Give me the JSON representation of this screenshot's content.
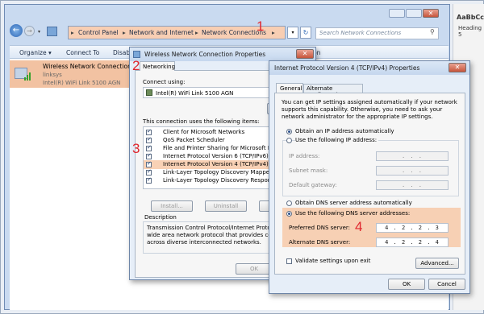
{
  "explorer": {
    "breadcrumb": [
      "Control Panel",
      "Network and Internet",
      "Network Connections"
    ],
    "breadcrumb_sep": "▸",
    "search_placeholder": "Search Network Connections",
    "toolbar": [
      "Organize ▾",
      "Connect To",
      "Disab",
      "ion"
    ],
    "connection": {
      "name": "Wireless Network Connection",
      "ssid": "linksys",
      "adapter": "Intel(R) WiFi Link 5100 AGN"
    }
  },
  "word": {
    "style_preview": "AaBbCcDd",
    "style_name": "Heading 5"
  },
  "props": {
    "title": "Wireless Network Connection Properties",
    "tab": "Networking",
    "connect_using_label": "Connect using:",
    "adapter": "Intel(R) WiFi Link 5100 AGN",
    "items_label": "This connection uses the following items:",
    "items": [
      {
        "label": "Client for Microsoft Networks",
        "checked": true
      },
      {
        "label": "QoS Packet Scheduler",
        "checked": true
      },
      {
        "label": "File and Printer Sharing for Microsoft Netwo",
        "checked": true
      },
      {
        "label": "Internet Protocol Version 6 (TCP/IPv6)",
        "checked": true
      },
      {
        "label": "Internet Protocol Version 4 (TCP/IPv4)",
        "checked": true
      },
      {
        "label": "Link-Layer Topology Discovery Mapper I/O",
        "checked": true
      },
      {
        "label": "Link-Layer Topology Discovery Responder",
        "checked": true
      }
    ],
    "install": "Install...",
    "uninstall": "Uninstall",
    "description_label": "Description",
    "description": "Transmission Control Protocol/Internet Protocol. Th wide area network protocol that provides commun across diverse interconnected networks.",
    "ok": "OK"
  },
  "ipv4": {
    "title": "Internet Protocol Version 4 (TCP/IPv4) Properties",
    "tabs": [
      "General",
      "Alternate Configuration"
    ],
    "intro": "You can get IP settings assigned automatically if your network supports this capability. Otherwise, you need to ask your network administrator for the appropriate IP settings.",
    "obtain_ip": "Obtain an IP address automatically",
    "use_ip": "Use the following IP address:",
    "ip_address": "IP address:",
    "subnet": "Subnet mask:",
    "gateway": "Default gateway:",
    "empty_ip": ". . .",
    "obtain_dns": "Obtain DNS server address automatically",
    "use_dns": "Use the following DNS server addresses:",
    "preferred_label": "Preferred DNS server:",
    "preferred": "4 . 2 . 2 . 3",
    "alternate_label": "Alternate DNS server:",
    "alternate": "4 . 2 . 2 . 4",
    "validate": "Validate settings upon exit",
    "advanced": "Advanced...",
    "ok": "OK",
    "cancel": "Cancel"
  },
  "markers": [
    "1",
    "2",
    "3",
    "4"
  ],
  "colors": {
    "highlight": "#f4b38a",
    "marker": "#e0262e"
  }
}
